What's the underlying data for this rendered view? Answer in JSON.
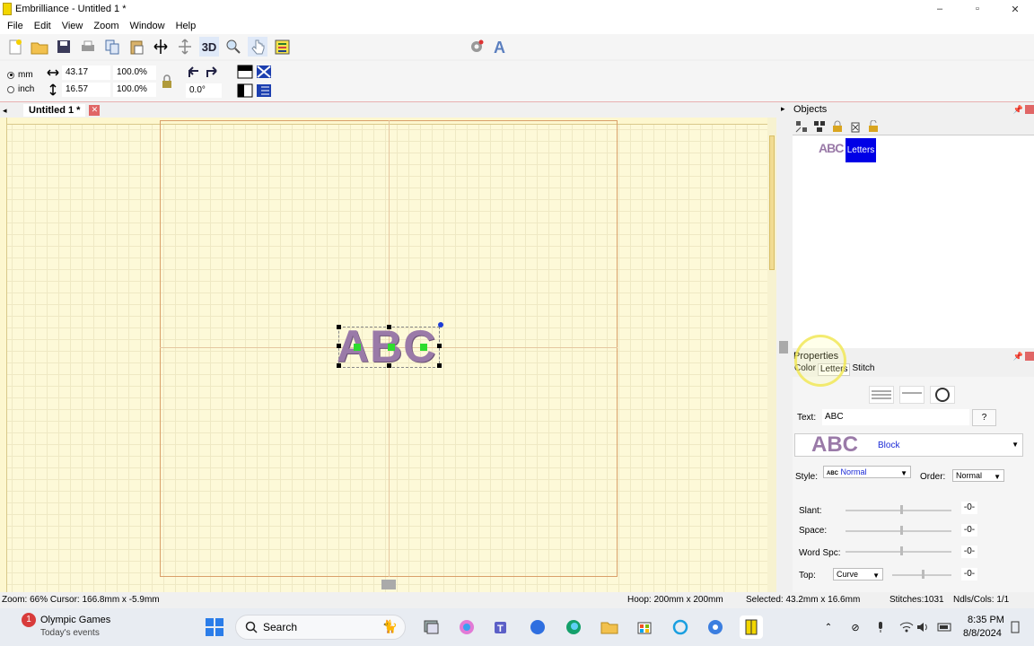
{
  "window": {
    "title": "Embrilliance -  Untitled 1 *",
    "minimize": "–",
    "restore": "▫",
    "close": "✕"
  },
  "menu": [
    "File",
    "Edit",
    "View",
    "Zoom",
    "Window",
    "Help"
  ],
  "toolbar": {
    "three_d_label": "3D"
  },
  "dimensions": {
    "unit_mm": "mm",
    "unit_inch": "inch",
    "selected_unit": "mm",
    "width": "43.17",
    "height": "16.57",
    "width_pct": "100.0%",
    "height_pct": "100.0%",
    "rotation": "0.0°"
  },
  "document": {
    "tab_label": "Untitled 1 *",
    "design_text": "ABC"
  },
  "objects_panel": {
    "title": "Objects",
    "thumb_text": "ABC",
    "item_label": "Letters"
  },
  "properties_panel": {
    "title": "Properties",
    "tabs": [
      "Color",
      "Letters",
      "Stitch"
    ],
    "text_label": "Text:",
    "text_value": "ABC",
    "help_label": "?",
    "font_preview": "ABC",
    "font_name": "Block",
    "style_label": "Style:",
    "style_prefix": "ABC",
    "style_value": "Normal",
    "order_label": "Order:",
    "order_value": "Normal",
    "slant_label": "Slant:",
    "slant_value": "-0-",
    "space_label": "Space:",
    "space_value": "-0-",
    "word_spc_label": "Word Spc:",
    "word_spc_value": "-0-",
    "top_label": "Top:",
    "top_mode": "Curve",
    "top_value": "-0-"
  },
  "status": {
    "zoom_cursor": "Zoom: 66%  Cursor: 166.8mm x -5.9mm",
    "hoop": "Hoop: 200mm x 200mm",
    "selected": "Selected: 43.2mm x 16.6mm",
    "stitches": "Stitches:1031",
    "ndls": "Ndls/Cols: 1/1"
  },
  "taskbar": {
    "news_badge": "1",
    "news_title": "Olympic Games",
    "news_sub": "Today's events",
    "search_label": "Search",
    "time": "8:35 PM",
    "date": "8/8/2024"
  },
  "colors": {
    "canvas": "#fdf9d8",
    "letters": "#9a7aa8",
    "selection_blue": "#0000e6",
    "hoop_border": "#d9a06a"
  }
}
